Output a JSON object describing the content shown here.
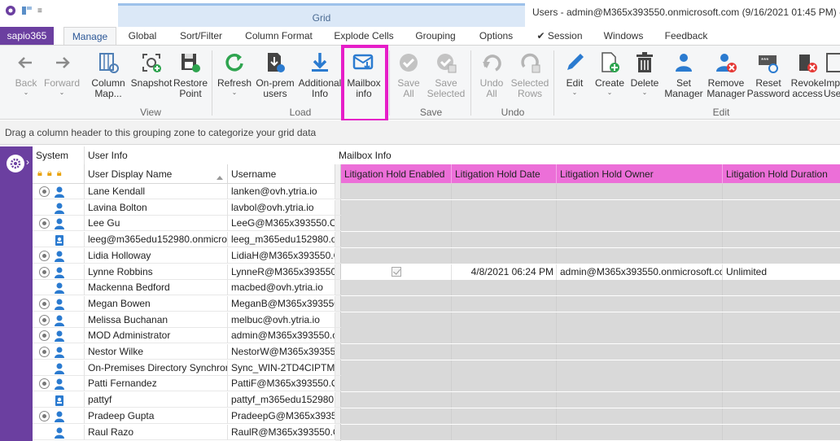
{
  "window": {
    "title": "Users - admin@M365x393550.onmicrosoft.com (9/16/2021 01:45 PM) - A",
    "context_tab": "Grid"
  },
  "tabs": {
    "app": "sapio365",
    "items": [
      "Manage",
      "Global",
      "Sort/Filter",
      "Column Format",
      "Explode Cells",
      "Grouping",
      "Options",
      "✔ Session",
      "Windows",
      "Feedback"
    ],
    "active": "Manage"
  },
  "ribbon": {
    "buttons": {
      "back": "Back",
      "forward": "Forward",
      "column_map_1": "Column",
      "column_map_2": "Map...",
      "snapshot": "Snapshot",
      "restore_1": "Restore",
      "restore_2": "Point",
      "refresh": "Refresh",
      "onprem_1": "On-prem",
      "onprem_2": "users",
      "additional_1": "Additional",
      "additional_2": "Info",
      "mailbox_1": "Mailbox",
      "mailbox_2": "info",
      "save_all_1": "Save",
      "save_all_2": "All",
      "save_sel_1": "Save",
      "save_sel_2": "Selected",
      "undo_all_1": "Undo",
      "undo_all_2": "All",
      "undo_sel_1": "Selected",
      "undo_sel_2": "Rows",
      "edit": "Edit",
      "create": "Create",
      "delete": "Delete",
      "set_mgr_1": "Set",
      "set_mgr_2": "Manager",
      "rem_mgr_1": "Remove",
      "rem_mgr_2": "Manager",
      "reset_1": "Reset",
      "reset_2": "Password",
      "revoke_1": "Revoke",
      "revoke_2": "access",
      "imp_1": "Imp",
      "imp_2": "Use"
    },
    "groups": {
      "view": "View",
      "load": "Load",
      "save": "Save",
      "undo": "Undo",
      "edit": "Edit"
    },
    "highlight_color": "#e61ec8"
  },
  "grouping_zone": "Drag a column header to this grouping zone to categorize your grid data",
  "grid": {
    "group_headers": {
      "system": "System",
      "user_info": "User Info",
      "mailbox_info": "Mailbox Info"
    },
    "columns": {
      "display_name": "User Display Name",
      "username": "Username",
      "lh_enabled": "Litigation Hold Enabled",
      "lh_date": "Litigation Hold Date",
      "lh_owner": "Litigation Hold Owner",
      "lh_duration": "Litigation Hold Duration"
    },
    "rows": [
      {
        "name": "Lane Kendall",
        "username": "lanken@ovh.ytria.io",
        "radio": true,
        "icon": "user"
      },
      {
        "name": "Lavina Bolton",
        "username": "lavbol@ovh.ytria.io",
        "radio": false,
        "icon": "user"
      },
      {
        "name": "Lee Gu",
        "username": "LeeG@M365x393550.OnM",
        "radio": true,
        "icon": "user"
      },
      {
        "name": "leeg@m365edu152980.onmicros",
        "username": "leeg_m365edu152980.onr",
        "radio": false,
        "icon": "guest"
      },
      {
        "name": "Lidia Holloway",
        "username": "LidiaH@M365x393550.Or",
        "radio": true,
        "icon": "user"
      },
      {
        "name": "Lynne Robbins",
        "username": "LynneR@M365x393550.O",
        "radio": true,
        "icon": "user",
        "lh_enabled": true,
        "lh_date": "4/8/2021 06:24 PM",
        "lh_owner": "admin@M365x393550.onmicrosoft.coı",
        "lh_duration": "Unlimited"
      },
      {
        "name": "Mackenna Bedford",
        "username": "macbed@ovh.ytria.io",
        "radio": false,
        "icon": "user"
      },
      {
        "name": "Megan Bowen",
        "username": "MeganB@M365x393550.(",
        "radio": true,
        "icon": "user"
      },
      {
        "name": "Melissa Buchanan",
        "username": "melbuc@ovh.ytria.io",
        "radio": true,
        "icon": "user"
      },
      {
        "name": "MOD Administrator",
        "username": "admin@M365x393550.on",
        "radio": true,
        "icon": "user"
      },
      {
        "name": "Nestor Wilke",
        "username": "NestorW@M365x393550.(",
        "radio": true,
        "icon": "user"
      },
      {
        "name": "On-Premises Directory Synchron",
        "username": "Sync_WIN-2TD4CIPTM58_",
        "radio": false,
        "icon": "user"
      },
      {
        "name": "Patti Fernandez",
        "username": "PattiF@M365x393550.Onl",
        "radio": true,
        "icon": "user"
      },
      {
        "name": "pattyf",
        "username": "pattyf_m365edu152980.oı",
        "radio": false,
        "icon": "guest"
      },
      {
        "name": "Pradeep Gupta",
        "username": "PradeepG@M365x393550",
        "radio": true,
        "icon": "user"
      },
      {
        "name": "Raul Razo",
        "username": "RaulR@M365x393550.Onl",
        "radio": false,
        "icon": "user"
      }
    ]
  }
}
